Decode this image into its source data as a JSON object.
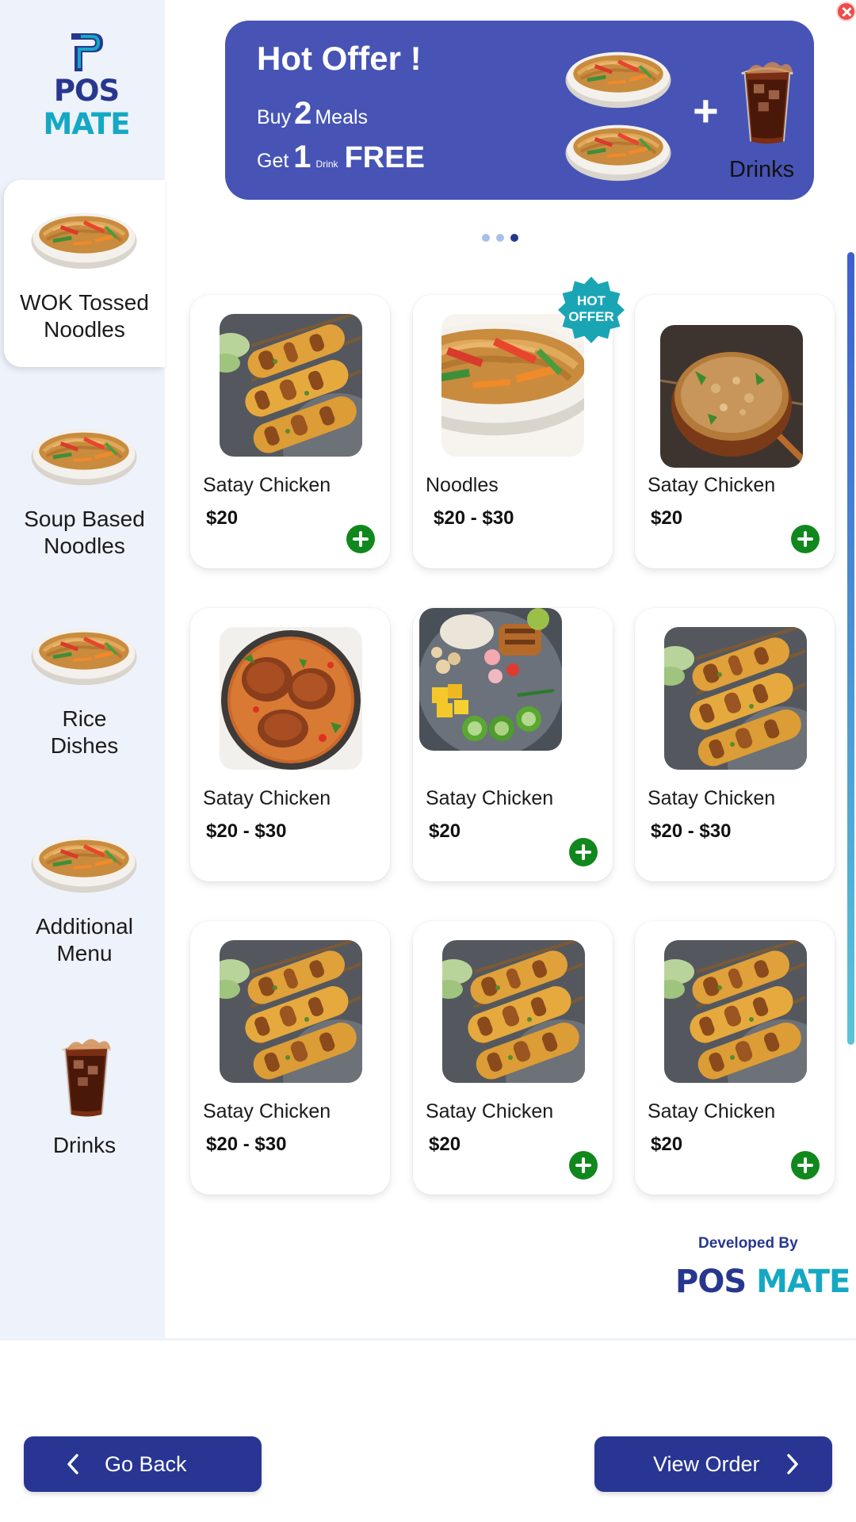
{
  "brand": {
    "name_left": "POS",
    "name_right": "MATE",
    "colors": {
      "navy": "#28378e",
      "teal": "#15a8c4"
    }
  },
  "categories": [
    {
      "label_line1": "WOK Tossed",
      "label_line2": "Noodles",
      "icon": "noodle-bowl-icon",
      "active": true
    },
    {
      "label_line1": "Soup Based",
      "label_line2": "Noodles",
      "icon": "noodle-bowl-icon",
      "active": false
    },
    {
      "label_line1": "Rice",
      "label_line2": "Dishes",
      "icon": "noodle-bowl-icon",
      "active": false
    },
    {
      "label_line1": "Additional",
      "label_line2": "Menu",
      "icon": "noodle-bowl-icon",
      "active": false
    },
    {
      "label_line1": "Drinks",
      "label_line2": "",
      "icon": "cola-glass-icon",
      "active": false
    }
  ],
  "banner": {
    "title": "Hot Offer !",
    "buy_word": "Buy",
    "buy_count": "2",
    "buy_item": "Meals",
    "get_word": "Get",
    "get_count": "1",
    "get_item": "Drink",
    "free_word": "FREE",
    "plus": "+",
    "drinks_label": "Drinks",
    "color": "#4754b5"
  },
  "carousel": {
    "total": 3,
    "active_index": 2
  },
  "hot_badge": {
    "line1": "HOT",
    "line2": "OFFER",
    "color": "#1aa5b5"
  },
  "products": [
    {
      "name": "Satay Chicken",
      "price": "$20",
      "image": "satay-skewers-icon",
      "has_add": true
    },
    {
      "name": "Noodles",
      "price": "$20 - $30",
      "image": "noodle-bowl-icon",
      "has_add": false
    },
    {
      "name": "Satay Chicken",
      "price": "$20",
      "image": "peanut-sauce-pot-icon",
      "has_add": true
    },
    {
      "name": "Satay Chicken",
      "price": "$20 - $30",
      "image": "chicken-curry-icon",
      "has_add": false
    },
    {
      "name": "Satay Chicken",
      "price": "$20",
      "image": "salad-bowl-icon",
      "has_add": true
    },
    {
      "name": "Satay Chicken",
      "price": "$20 - $30",
      "image": "satay-skewers-icon",
      "has_add": false
    },
    {
      "name": "Satay Chicken",
      "price": "$20 - $30",
      "image": "satay-skewers-icon",
      "has_add": false
    },
    {
      "name": "Satay Chicken",
      "price": "$20",
      "image": "satay-skewers-icon",
      "has_add": true
    },
    {
      "name": "Satay Chicken",
      "price": "$20",
      "image": "satay-skewers-icon",
      "has_add": true
    }
  ],
  "footer": {
    "developed_by": "Developed By",
    "logo_left": "POS",
    "logo_right": "MATE"
  },
  "nav": {
    "back_label": "Go Back",
    "view_order_label": "View Order",
    "color": "#283593"
  },
  "add_button_color": "#11881d"
}
